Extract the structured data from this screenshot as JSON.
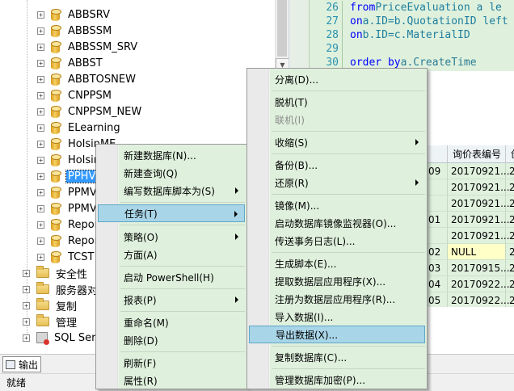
{
  "tree": {
    "databases": [
      "ABBSRV",
      "ABBSSM",
      "ABBSSM_SRV",
      "ABBST",
      "ABBTOSNEW",
      "CNPPSM",
      "CNPPSM_NEW",
      "ELearning",
      "HolsinME",
      "Holsin",
      "PPHVS",
      "PPMV",
      "PPMV",
      "Repor",
      "Repor",
      "TCST"
    ],
    "selected": "PPHVS",
    "folders": [
      "安全性",
      "服务器对象",
      "复制",
      "管理"
    ],
    "server_agent": "SQL Serve",
    "expander_symbol": "+"
  },
  "editor": {
    "lines": [
      {
        "num": "26",
        "kw": "from",
        "text": " PriceEvaluation a le"
      },
      {
        "num": "27",
        "kw": "on",
        "text": " a.ID=b.QuotationID left"
      },
      {
        "num": "28",
        "kw": "on",
        "text": " b.ID=c.MaterialID"
      },
      {
        "num": "29",
        "kw": "",
        "text": ""
      },
      {
        "num": "30",
        "kw": "order by",
        "text": " a.CreateTime"
      }
    ]
  },
  "results": {
    "header": "询价表编号",
    "header2": "创",
    "rows": [
      {
        "idx": "09",
        "val": "20170921...",
        "c": "2"
      },
      {
        "idx": "",
        "val": "20170921...",
        "c": "2"
      },
      {
        "idx": "",
        "val": "20170921...",
        "c": "2"
      },
      {
        "idx": "01",
        "val": "20170921...",
        "c": "2"
      },
      {
        "idx": "",
        "val": "20170921...",
        "c": "2"
      },
      {
        "idx": "02",
        "val": "NULL",
        "c": "2"
      },
      {
        "idx": "03",
        "val": "20170915...",
        "c": "2"
      },
      {
        "idx": "04",
        "val": "20170922...",
        "c": "2"
      },
      {
        "idx": "05",
        "val": "20170922...",
        "c": "2"
      }
    ]
  },
  "context_menu": {
    "items": [
      "新建数据库(N)...",
      "新建查询(Q)",
      "编写数据库脚本为(S)",
      "任务(T)",
      "策略(O)",
      "方面(A)",
      "启动 PowerShell(H)",
      "报表(P)",
      "重命名(M)",
      "删除(D)",
      "刷新(F)",
      "属性(R)"
    ]
  },
  "tasks_menu": {
    "items": [
      "分离(D)...",
      "脱机(T)",
      "联机(I)",
      "收缩(S)",
      "备份(B)...",
      "还原(R)",
      "镜像(M)...",
      "启动数据库镜像监视器(O)...",
      "传送事务日志(L)...",
      "生成脚本(E)...",
      "提取数据层应用程序(X)...",
      "注册为数据层应用程序(R)...",
      "导入数据(I)...",
      "导出数据(X)...",
      "复制数据库(C)...",
      "管理数据库加密(P)..."
    ]
  },
  "bottom": {
    "output_tab": "输出",
    "status": "就绪"
  }
}
